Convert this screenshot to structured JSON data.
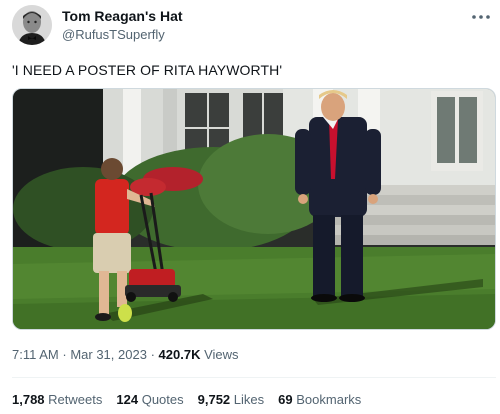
{
  "author": {
    "display_name": "Tom Reagan's Hat",
    "handle": "@RufusTSuperfly",
    "avatar": "avatar-photo"
  },
  "tweet": {
    "text": "'I NEED A POSTER OF RITA HAYWORTH'"
  },
  "media": {
    "type": "photo",
    "description_icon": "photo-image"
  },
  "meta": {
    "time": "7:11 AM",
    "separator": "·",
    "date": "Mar 31, 2023",
    "views_count": "420.7K",
    "views_label": "Views"
  },
  "stats": {
    "retweets_count": "1,788",
    "retweets_label": "Retweets",
    "quotes_count": "124",
    "quotes_label": "Quotes",
    "likes_count": "9,752",
    "likes_label": "Likes",
    "bookmarks_count": "69",
    "bookmarks_label": "Bookmarks"
  },
  "colors": {
    "primary_text": "#0f1419",
    "secondary_text": "#536471",
    "divider": "#eff3f4",
    "tie_red": "#c8102e"
  },
  "icons": {
    "more": "more-dots-icon"
  }
}
